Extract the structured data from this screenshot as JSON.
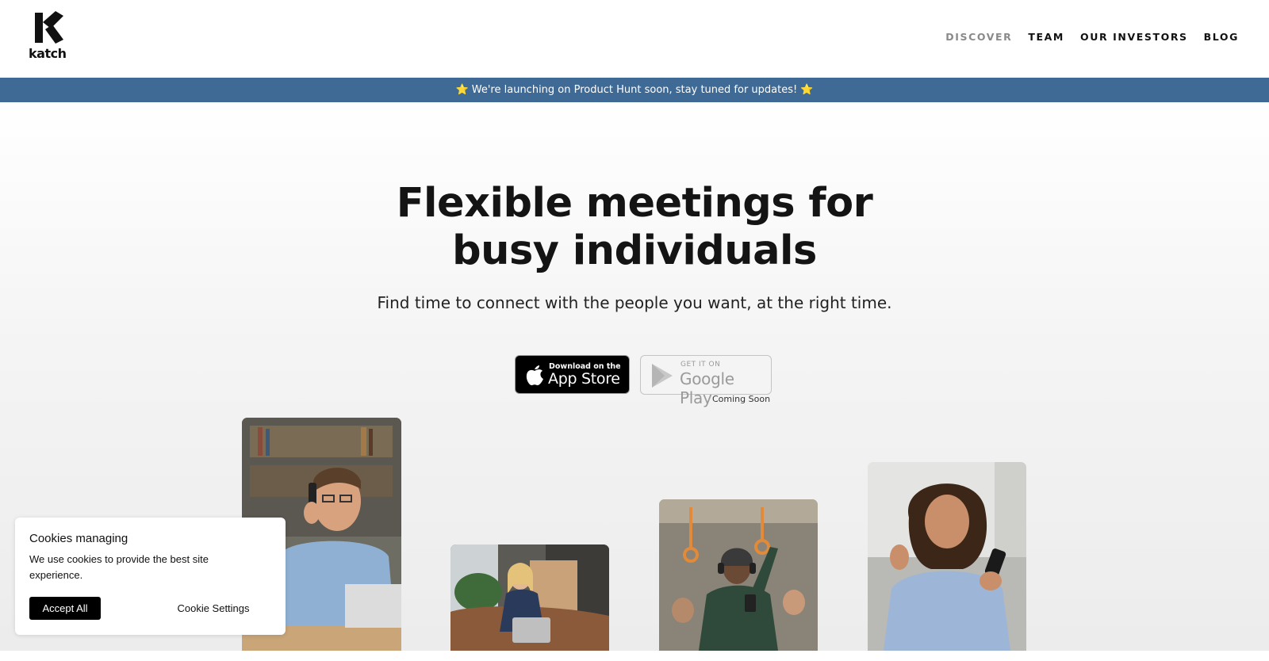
{
  "header": {
    "logo_text": "katch",
    "nav": [
      {
        "label": "DISCOVER"
      },
      {
        "label": "TEAM"
      },
      {
        "label": "OUR INVESTORS"
      },
      {
        "label": "BLOG"
      }
    ]
  },
  "banner": {
    "text": "⭐ We're launching on Product Hunt soon, stay tuned for updates! ⭐"
  },
  "hero": {
    "title_line1": "Flexible meetings for",
    "title_line2": "busy individuals",
    "subtitle": "Find time to connect with the people you want, at the right time.",
    "app_store": {
      "small": "Download on the",
      "big": "App Store"
    },
    "google_play": {
      "small": "GET IT ON",
      "big": "Google Play",
      "note": "Coming Soon"
    },
    "photos": [
      {
        "icon": "man-on-phone-photo"
      },
      {
        "icon": "woman-on-sofa-photo"
      },
      {
        "icon": "man-on-train-photo"
      },
      {
        "icon": "woman-with-phone-photo"
      }
    ]
  },
  "cookie": {
    "title": "Cookies managing",
    "text": "We use cookies to provide the best site experience.",
    "accept_label": "Accept All",
    "settings_label": "Cookie Settings"
  },
  "colors": {
    "banner": "#3f6a96",
    "nav_active": "#8a8a8a",
    "text": "#111111"
  }
}
